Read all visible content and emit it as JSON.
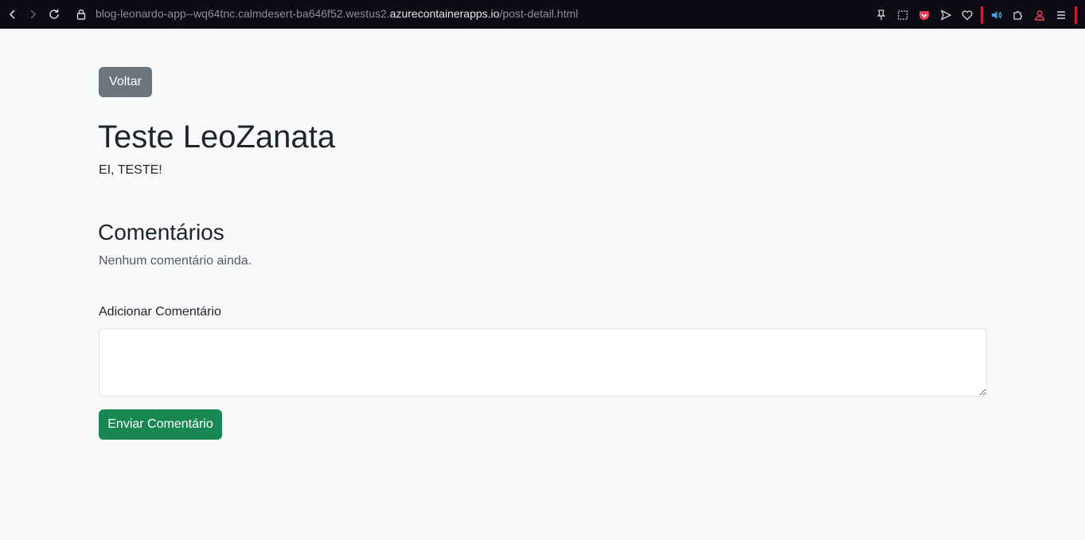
{
  "browser": {
    "url_prefix": "blog-leonardo-app--wq64tnc.calmdesert-ba646f52.westus2.",
    "url_host": "azurecontainerapps.io",
    "url_path": "/post-detail.html"
  },
  "page": {
    "back_label": "Voltar",
    "post_title": "Teste LeoZanata",
    "post_content": "EI, TESTE!",
    "comments_heading": "Comentários",
    "no_comments": "Nenhum comentário ainda.",
    "add_comment_label": "Adicionar Comentário",
    "comment_value": "",
    "submit_label": "Enviar Comentário"
  },
  "colors": {
    "back_button": "#6c757d",
    "submit_button": "#198754",
    "background": "#f8f9fa"
  }
}
